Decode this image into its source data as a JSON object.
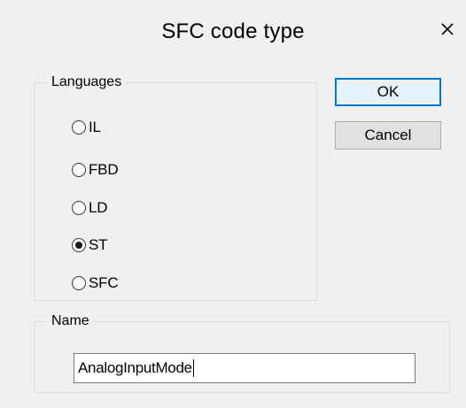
{
  "dialog": {
    "title": "SFC code type",
    "close_icon": "close-icon"
  },
  "languages": {
    "legend": "Languages",
    "options": [
      {
        "label": "IL",
        "selected": false
      },
      {
        "label": "FBD",
        "selected": false
      },
      {
        "label": "LD",
        "selected": false
      },
      {
        "label": "ST",
        "selected": true
      },
      {
        "label": "SFC",
        "selected": false
      }
    ]
  },
  "buttons": {
    "ok_label": "OK",
    "cancel_label": "Cancel"
  },
  "name": {
    "legend": "Name",
    "value": "AnalogInputMode"
  },
  "colors": {
    "ok_border": "#0078d7",
    "ok_background": "#e5f1fb",
    "dialog_background": "#f0f0f0"
  }
}
